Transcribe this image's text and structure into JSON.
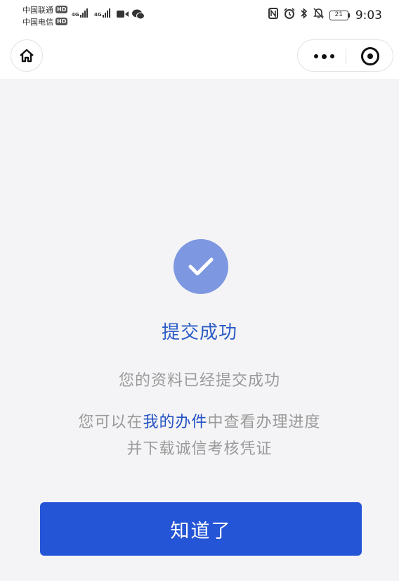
{
  "status_bar": {
    "carrier_1": "中国联通",
    "carrier_2": "中国电信",
    "hd_badge": "HD",
    "network_1": "4G",
    "network_2": "4G",
    "battery": "21",
    "time": "9:03"
  },
  "nav": {
    "home_icon": "home-icon",
    "more_icon": "more-dots-icon",
    "close_icon": "target-close-icon"
  },
  "result": {
    "icon": "check-circle-icon",
    "accent_color": "#2a5bc6",
    "title": "提交成功",
    "message": "您的资料已经提交成功",
    "hint_prefix": "您可以在",
    "hint_link": "我的办件",
    "hint_suffix": "中查看办理进度",
    "hint_line2": "并下载诚信考核凭证"
  },
  "actions": {
    "confirm_label": "知道了",
    "confirm_color": "#2455d6"
  }
}
